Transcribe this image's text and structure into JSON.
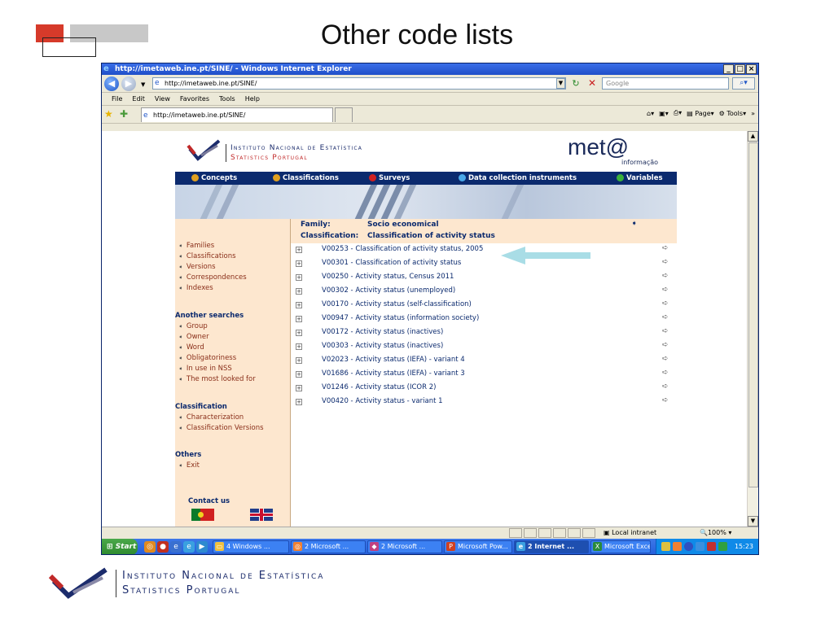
{
  "slide": {
    "title": "Other code lists",
    "footer_line1": "Instituto Nacional de Estatística",
    "footer_line2": "Statistics Portugal"
  },
  "window": {
    "title": "http://imetaweb.ine.pt/SINE/ - Windows Internet Explorer",
    "url": "http://imetaweb.ine.pt/SINE/",
    "search_placeholder": "Google",
    "tab_label": "http://imetaweb.ine.pt/SINE/",
    "menu": [
      "File",
      "Edit",
      "View",
      "Favorites",
      "Tools",
      "Help"
    ],
    "command_bar": {
      "page": "Page",
      "tools": "Tools"
    },
    "status_zone": "Local intranet",
    "zoom": "100%"
  },
  "site": {
    "logo_line1": "Instituto Nacional de Estatística",
    "logo_line2": "Statistics Portugal",
    "brand": "met@",
    "brand_sub": "informação",
    "nav": [
      {
        "label": "Concepts",
        "color": "#e0a020"
      },
      {
        "label": "Classifications",
        "color": "#e0a020"
      },
      {
        "label": "Surveys",
        "color": "#d02020"
      },
      {
        "label": "Data collection instruments",
        "color": "#4aa8e8"
      },
      {
        "label": "Variables",
        "color": "#3ab03a"
      }
    ],
    "left_menu": {
      "main_items": [
        "Families",
        "Classifications",
        "Versions",
        "Correspondences",
        "Indexes"
      ],
      "another_head": "Another searches",
      "another_items": [
        "Group",
        "Owner",
        "Word",
        "Obligatoriness",
        "In use in NSS",
        "The most looked for"
      ],
      "class_head": "Classification",
      "class_items": [
        "Characterization",
        "Classification Versions"
      ],
      "others_head": "Others",
      "others_items": [
        "Exit"
      ],
      "contact": "Contact us"
    },
    "family_label": "Family:",
    "family_value": "Socio economical",
    "classification_label": "Classification:",
    "classification_value": "Classification of activity status",
    "rows": [
      "V00253 - Classification of activity status, 2005",
      "V00301 - Classification of activity status",
      "V00250 - Activity status, Census 2011",
      "V00302 - Activity status (unemployed)",
      "V00170 - Activity status (self-classification)",
      "V00947 - Activity status (information society)",
      "V00172 - Activity status (inactives)",
      "V00303 - Activity status (inactives)",
      "V02023 - Activity status (IEFA) - variant 4",
      "V01686 - Activity status (IEFA) - variant 3",
      "V01246 - Activity status (ICOR 2)",
      "V00420 - Activity status - variant 1"
    ]
  },
  "taskbar": {
    "start": "Start",
    "buttons": [
      "4 Windows ...",
      "2 Microsoft ...",
      "2 Microsoft ...",
      "Microsoft Pow...",
      "2 Internet ...",
      "Microsoft Excel"
    ],
    "clock": "15:23"
  },
  "icons": {
    "nav_back": "back-arrow-icon",
    "nav_forward": "forward-arrow-icon",
    "refresh": "refresh-icon",
    "stop": "stop-icon",
    "search": "search-icon",
    "favorites": "favorites-star-icon",
    "expand": "plus-expand-icon",
    "go": "go-arrow-icon"
  },
  "colors": {
    "nav_bg": "#0b2a6e",
    "pane_bg": "#fde7cf",
    "link": "#8a2f1a",
    "heading": "#0b2a6e",
    "accent_red": "#d63a2a"
  }
}
